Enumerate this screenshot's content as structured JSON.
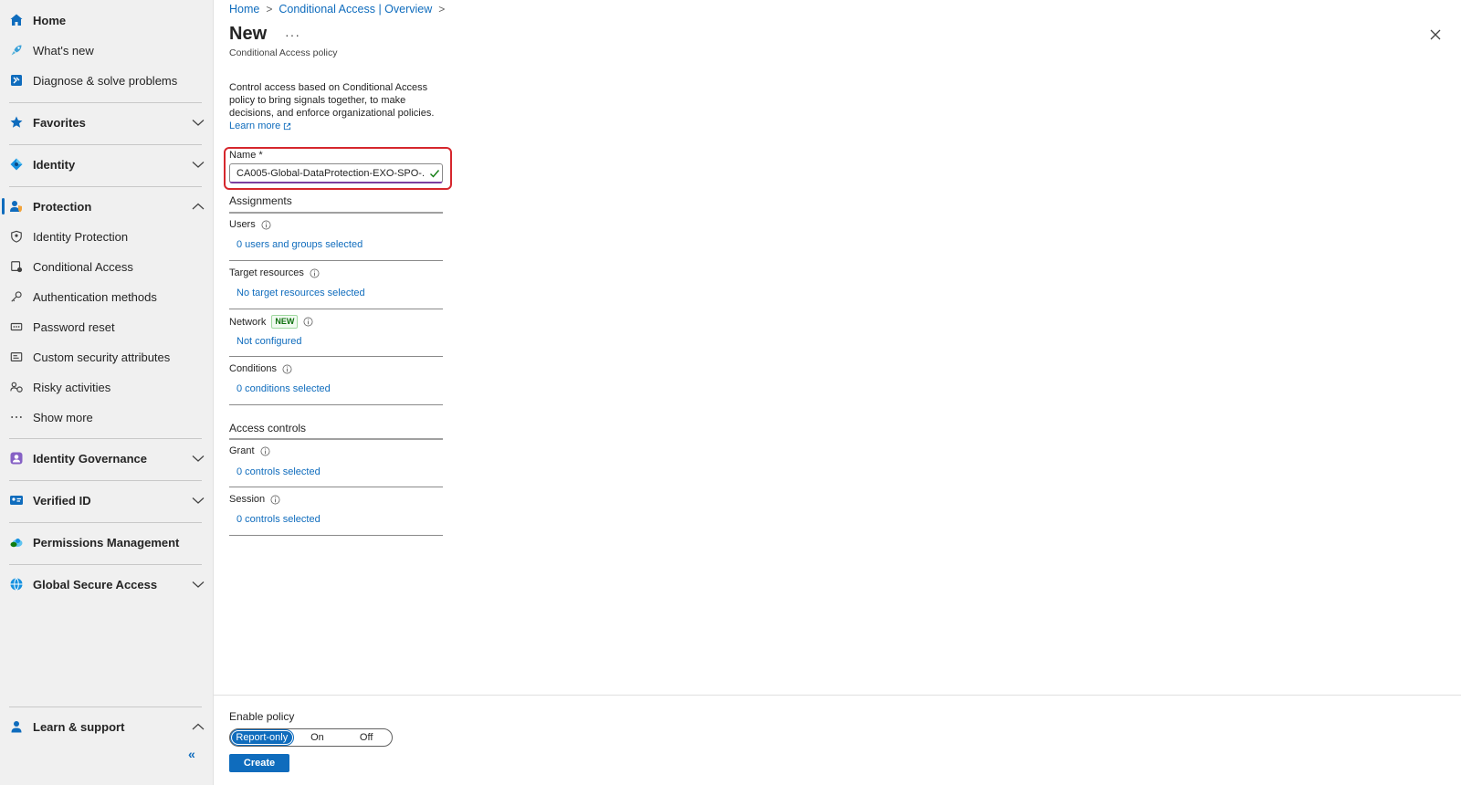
{
  "sidebar": {
    "home": "Home",
    "whats_new": "What's new",
    "diagnose": "Diagnose & solve problems",
    "favorites": "Favorites",
    "identity": "Identity",
    "protection": "Protection",
    "identity_protection": "Identity Protection",
    "conditional_access": "Conditional Access",
    "authentication_methods": "Authentication methods",
    "password_reset": "Password reset",
    "custom_security_attributes": "Custom security attributes",
    "risky_activities": "Risky activities",
    "show_more": "Show more",
    "identity_governance": "Identity Governance",
    "verified_id": "Verified ID",
    "permissions_management": "Permissions Management",
    "global_secure_access": "Global Secure Access",
    "learn_support": "Learn & support",
    "collapse_glyph": "«"
  },
  "breadcrumb": {
    "home": "Home",
    "overview": "Conditional Access | Overview"
  },
  "page": {
    "title": "New",
    "more": "···",
    "subtitle": "Conditional Access policy",
    "description": "Control access based on Conditional Access policy to bring signals together, to make decisions, and enforce organizational policies.",
    "learn_more": "Learn more"
  },
  "form": {
    "name_label": "Name *",
    "name_value": "CA005-Global-DataProtection-EXO-SPO-..."
  },
  "assignments": {
    "title": "Assignments",
    "users_label": "Users",
    "users_value": "0 users and groups selected",
    "target_label": "Target resources",
    "target_value": "No target resources selected",
    "network_label": "Network",
    "network_badge": "NEW",
    "network_value": "Not configured",
    "conditions_label": "Conditions",
    "conditions_value": "0 conditions selected"
  },
  "access_controls": {
    "title": "Access controls",
    "grant_label": "Grant",
    "grant_value": "0 controls selected",
    "session_label": "Session",
    "session_value": "0 controls selected"
  },
  "footer": {
    "enable_label": "Enable policy",
    "options": [
      "Report-only",
      "On",
      "Off"
    ],
    "selected": "Report-only",
    "create": "Create"
  },
  "colors": {
    "accent": "#0f6cbd",
    "highlight": "#d6272d",
    "valid_check": "#107c10"
  },
  "icons": {
    "home": "home-icon",
    "whats_new": "rocket-icon",
    "diagnose": "diagnose-icon",
    "favorites": "star-icon",
    "identity": "identity-diamond-icon",
    "protection": "user-shield-icon",
    "close": "close-icon"
  }
}
